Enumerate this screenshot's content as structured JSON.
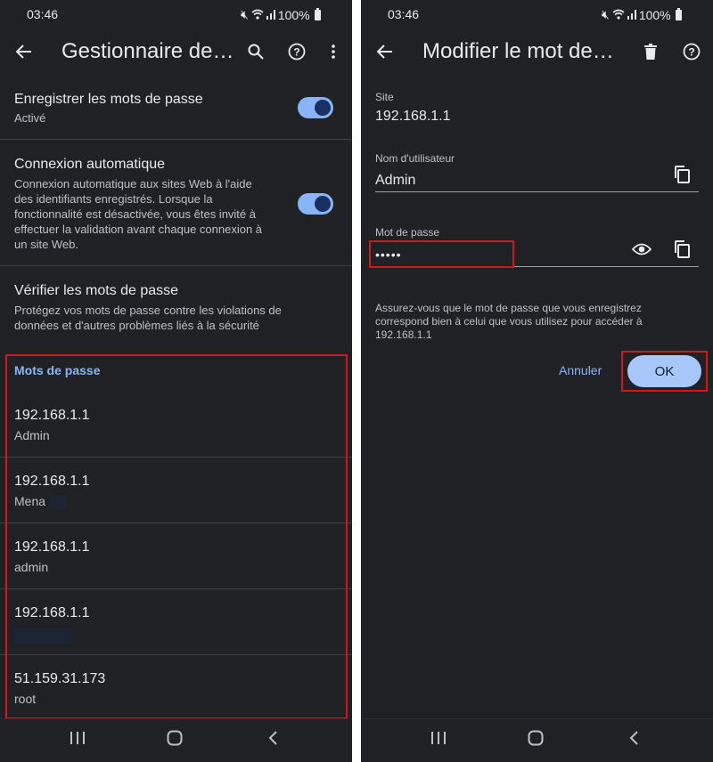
{
  "status_bar": {
    "time": "03:46",
    "battery": "100%"
  },
  "left": {
    "title": "Gestionnaire de…",
    "settings": [
      {
        "title": "Enregistrer les mots de passe",
        "subtitle": "Activé",
        "toggle": true
      },
      {
        "title": "Connexion automatique",
        "subtitle": "Connexion automatique aux sites Web à l'aide des identifiants enregistrés. Lorsque la fonctionnalité est désactivée, vous êtes invité à effectuer la validation avant chaque connexion à un site Web.",
        "toggle": true
      },
      {
        "title": "Vérifier les mots de passe",
        "subtitle": "Protégez vos mots de passe contre les violations de données et d'autres problèmes liés à la sécurité"
      }
    ],
    "section_header": "Mots de passe",
    "passwords": [
      {
        "site": "192.168.1.1",
        "username": "Admin"
      },
      {
        "site": "192.168.1.1",
        "username": "Mena"
      },
      {
        "site": "192.168.1.1",
        "username": "admin"
      },
      {
        "site": "192.168.1.1",
        "username": ""
      },
      {
        "site": "51.159.31.173",
        "username": "root"
      }
    ]
  },
  "right": {
    "title": "Modifier le mot de…",
    "site_label": "Site",
    "site_value": "192.168.1.1",
    "username_label": "Nom d'utilisateur",
    "username_value": "Admin",
    "password_label": "Mot de passe",
    "password_value": "•••••",
    "hint": "Assurez-vous que le mot de passe que vous enregistrez correspond bien à celui que vous utilisez pour accéder à 192.168.1.1",
    "cancel_label": "Annuler",
    "ok_label": "OK"
  },
  "colors": {
    "background": "#202124",
    "accent": "#8ab4f8",
    "highlight": "#d4161b"
  }
}
